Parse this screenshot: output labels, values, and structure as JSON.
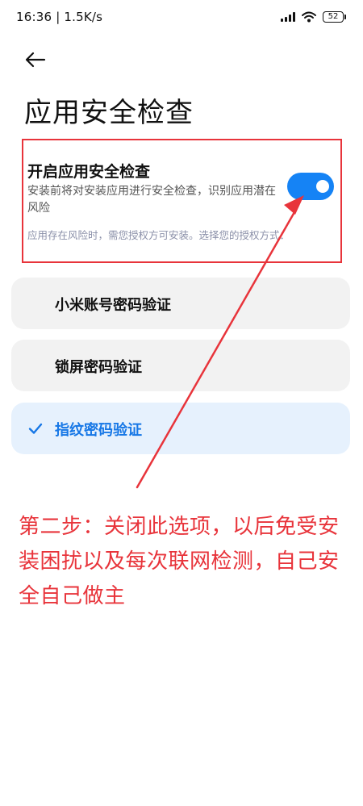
{
  "status_bar": {
    "time_speed": "16:36 | 1.5K/s",
    "battery": "52"
  },
  "page": {
    "title": "应用安全检查"
  },
  "security_toggle": {
    "title": "开启应用安全检查",
    "description": "安装前将对安装应用进行安全检查，识别应用潜在风险",
    "note": "应用存在风险时，需您授权方可安装。选择您的授权方式：",
    "state": "on"
  },
  "auth_options": [
    {
      "label": "小米账号密码验证",
      "selected": false
    },
    {
      "label": "锁屏密码验证",
      "selected": false
    },
    {
      "label": "指纹密码验证",
      "selected": true
    }
  ],
  "annotation": {
    "text": "第二步：关闭此选项，以后免受安装困扰以及每次联网检测，自己安全自己做主",
    "color": "#e8343b"
  },
  "colors": {
    "accent": "#1583f5",
    "selected_text": "#1677e6",
    "annotation": "#e8343b"
  }
}
